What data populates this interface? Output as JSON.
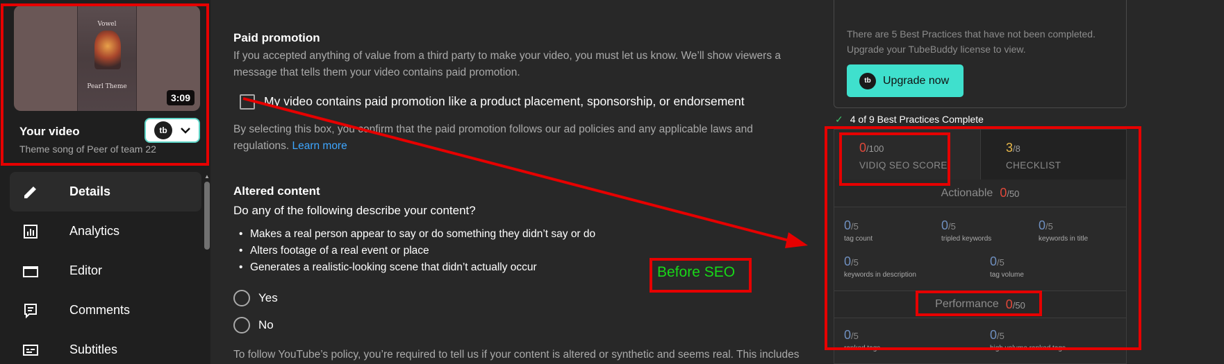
{
  "sidebar": {
    "video": {
      "duration": "3:09",
      "title": "Your video",
      "subtitle": "Theme song of Peer of team 22",
      "tubebuddy_logo": "tb",
      "poster_title": "Vowel",
      "poster_bottom": "Pearl Theme"
    },
    "nav": [
      {
        "label": "Details",
        "icon": "pencil-icon"
      },
      {
        "label": "Analytics",
        "icon": "analytics-icon"
      },
      {
        "label": "Editor",
        "icon": "clapper-icon"
      },
      {
        "label": "Comments",
        "icon": "comment-icon"
      },
      {
        "label": "Subtitles",
        "icon": "subtitles-icon"
      }
    ]
  },
  "main": {
    "paid_promotion": {
      "title": "Paid promotion",
      "desc1": "If you accepted anything of value from a third party to make your video, you must let us know. We’ll show viewers a",
      "desc2": "message that tells them your video contains paid promotion.",
      "checkbox_label": "My video contains paid promotion like a product placement, sponsorship, or endorsement",
      "confirm1": "By selecting this box, you confirm that the paid promotion follows our ad policies and any applicable laws and",
      "confirm2": "regulations.",
      "learn_more": "Learn more"
    },
    "altered_content": {
      "title": "Altered content",
      "question": "Do any of the following describe your content?",
      "bullets": [
        "Makes a real person appear to say or do something they didn’t say or do",
        "Alters footage of a real event or place",
        "Generates a realistic-looking scene that didn’t actually occur"
      ],
      "yes": "Yes",
      "no": "No",
      "policy": "To follow YouTube’s policy, you’re required to tell us if your content is altered or synthetic and seems real. This includes"
    }
  },
  "tubebuddy": {
    "notice1": "There are 5 Best Practices that have not been completed.",
    "notice2": "Upgrade your TubeBuddy license to view.",
    "upgrade": "Upgrade now",
    "best_practices": "4 of 9 Best Practices Complete"
  },
  "vidiq": {
    "seo_score": "0",
    "seo_den": "/100",
    "seo_label": "VIDIQ SEO SCORE",
    "checklist_score": "3",
    "checklist_den": "/8",
    "checklist_label": "CHECKLIST",
    "actionable": {
      "title": "Actionable",
      "value": "0",
      "den": "/50"
    },
    "metrics": [
      {
        "value": "0",
        "den": "/5",
        "label": "tag count"
      },
      {
        "value": "0",
        "den": "/5",
        "label": "tripled keywords"
      },
      {
        "value": "0",
        "den": "/5",
        "label": "keywords in title"
      },
      {
        "value": "0",
        "den": "/5",
        "label": "keywords in description"
      },
      {
        "value": "0",
        "den": "/5",
        "label": "tag volume"
      }
    ],
    "performance": {
      "title": "Performance",
      "value": "0",
      "den": "/50"
    },
    "perf_metrics": [
      {
        "value": "0",
        "den": "/5",
        "label": "ranked tags"
      },
      {
        "value": "0",
        "den": "/5",
        "label": "high volume ranked tags"
      }
    ]
  },
  "annotation": {
    "label": "Before SEO",
    "color": "#e60000",
    "label_color": "#18d818"
  }
}
